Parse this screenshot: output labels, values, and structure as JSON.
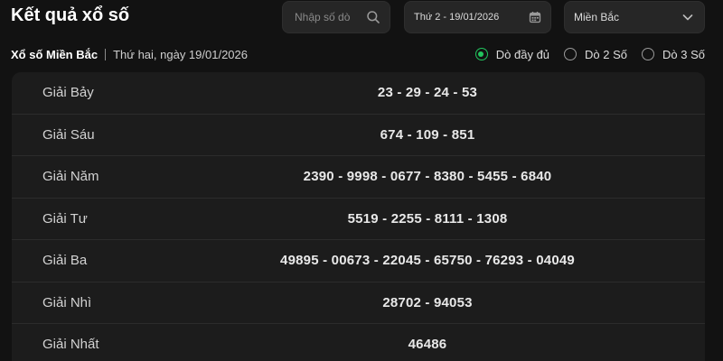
{
  "header": {
    "title": "Kết quả xổ số",
    "search_placeholder": "Nhập số dò",
    "date_value": "Thứ 2 - 19/01/2026",
    "region_value": "Miền Bắc"
  },
  "subheader": {
    "title": "Xổ số Miền Bắc",
    "date_text": "Thứ hai, ngày 19/01/2026"
  },
  "radios": [
    {
      "label": "Dò đầy đủ",
      "selected": true
    },
    {
      "label": "Dò 2 Số",
      "selected": false
    },
    {
      "label": "Dò 3 Số",
      "selected": false
    }
  ],
  "results": [
    {
      "name": "Giải Bảy",
      "numbers": "23 - 29 - 24 - 53"
    },
    {
      "name": "Giải Sáu",
      "numbers": "674 - 109 - 851"
    },
    {
      "name": "Giải Năm",
      "numbers": "2390 - 9998 - 0677 - 8380 - 5455 - 6840"
    },
    {
      "name": "Giải Tư",
      "numbers": "5519 - 2255 - 8111 - 1308"
    },
    {
      "name": "Giải Ba",
      "numbers": "49895 - 00673 - 22045 - 65750 - 76293 - 04049"
    },
    {
      "name": "Giải Nhì",
      "numbers": "28702 - 94053"
    },
    {
      "name": "Giải Nhất",
      "numbers": "46486"
    }
  ],
  "colors": {
    "accent": "#22c55e",
    "background": "#121212",
    "panel": "#1c1c1c"
  },
  "icons": {
    "search": "search-icon",
    "calendar": "calendar-icon",
    "dropdown": "chevron-down-icon"
  }
}
